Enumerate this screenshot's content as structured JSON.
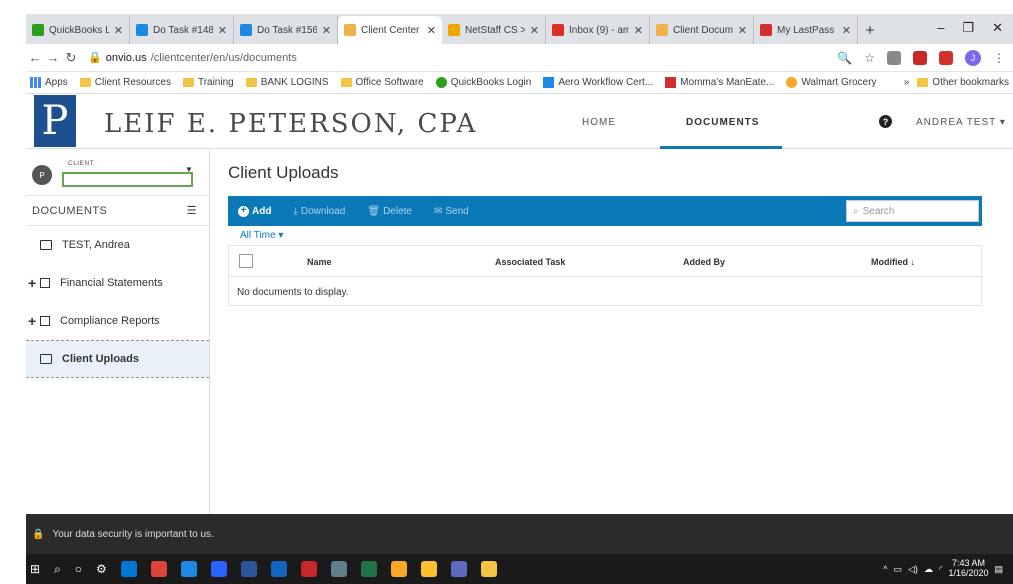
{
  "browser": {
    "tabs": [
      {
        "title": "QuickBooks Lo",
        "color": "#2ca01c"
      },
      {
        "title": "Do Task #148",
        "color": "#1e88e5"
      },
      {
        "title": "Do Task #156",
        "color": "#1e88e5"
      },
      {
        "title": "Client Center",
        "color": "#f0b34c",
        "active": true
      },
      {
        "title": "NetStaff CS >",
        "color": "#f0a500"
      },
      {
        "title": "Inbox (9) - am",
        "color": "#d93025"
      },
      {
        "title": "Client Docum",
        "color": "#f0b34c"
      },
      {
        "title": "My LastPass V",
        "color": "#d32f2f"
      }
    ],
    "tab_close": "✕",
    "new_tab": "+",
    "url_host": "onvio.us",
    "url_path": "/clientcenter/en/us/documents",
    "bookmarks": [
      {
        "label": "Apps",
        "icon": "apps"
      },
      {
        "label": "Client Resources",
        "icon": "folder"
      },
      {
        "label": "Training",
        "icon": "folder"
      },
      {
        "label": "BANK LOGINS",
        "icon": "folder"
      },
      {
        "label": "Office Software",
        "icon": "folder"
      },
      {
        "label": "QuickBooks Login",
        "icon": "qb"
      },
      {
        "label": "Aero Workflow Cert...",
        "icon": "aero"
      },
      {
        "label": "Momma's ManEate...",
        "icon": "red"
      },
      {
        "label": "Walmart Grocery",
        "icon": "walmart"
      }
    ],
    "bookmarks_more": "»",
    "other_bookmarks": "Other bookmarks",
    "profile_initial": "J"
  },
  "header": {
    "logo_letter": "P",
    "firm_name": "LEIF E. PETERSON, CPA",
    "nav": [
      {
        "label": "HOME"
      },
      {
        "label": "DOCUMENTS",
        "active": true
      }
    ],
    "help": "?",
    "user_name": "ANDREA TEST"
  },
  "sidebar": {
    "client_badge": "P",
    "client_label": "CLIENT",
    "documents_label": "DOCUMENTS",
    "items": [
      {
        "label": "TEST, Andrea",
        "expandable": false,
        "icon": "folder"
      },
      {
        "label": "Financial Statements",
        "expandable": true,
        "icon": "cabinet"
      },
      {
        "label": "Compliance Reports",
        "expandable": true,
        "icon": "cabinet"
      },
      {
        "label": "Client Uploads",
        "expandable": false,
        "icon": "folder",
        "active": true
      }
    ]
  },
  "main": {
    "title": "Client Uploads",
    "toolbar": {
      "add": "Add",
      "download": "Download",
      "delete": "Delete",
      "send": "Send"
    },
    "search_placeholder": "Search",
    "filter": "All Time",
    "columns": {
      "name": "Name",
      "task": "Associated Task",
      "added_by": "Added By",
      "modified": "Modified"
    },
    "empty_message": "No documents to display."
  },
  "footer": {
    "security": "Your data security is important to us."
  },
  "taskbar": {
    "time": "7:43 AM",
    "date": "1/16/2020"
  },
  "colors": {
    "accent": "#0b79b8",
    "logo": "#1e4f8f",
    "highlight": "#6aa84f"
  }
}
